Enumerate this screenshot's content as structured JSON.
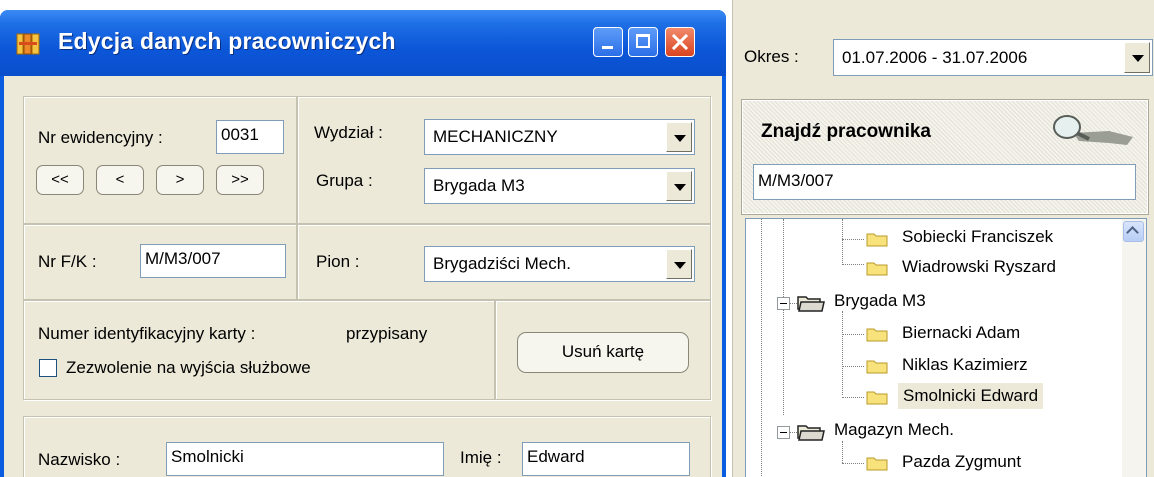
{
  "window": {
    "title": "Edycja danych pracowniczych"
  },
  "form": {
    "nr_ewidencyjny_label": "Nr ewidencyjny :",
    "nr_ewidencyjny_value": "0031",
    "nav": [
      "<<",
      "<",
      ">",
      ">>"
    ],
    "wydzial_label": "Wydział :",
    "wydzial_value": "MECHANICZNY",
    "grupa_label": "Grupa :",
    "grupa_value": "Brygada M3",
    "nr_fk_label": "Nr F/K :",
    "nr_fk_value": "M/M3/007",
    "pion_label": "Pion :",
    "pion_value": "Brygadziści Mech.",
    "karta_label": "Numer identyfikacyjny karty :",
    "karta_status": "przypisany",
    "usun_karte": "Usuń kartę",
    "zezwolenie_label": "Zezwolenie na wyjścia służbowe",
    "zezwolenie_checked": false,
    "nazwisko_label": "Nazwisko :",
    "nazwisko_value": "Smolnicki",
    "imie_label": "Imię :",
    "imie_value": "Edward"
  },
  "right_panel": {
    "okres_label": "Okres :",
    "okres_value": "01.07.2006 - 31.07.2006",
    "search_title": "Znajdź pracownika",
    "search_value": "M/M3/007",
    "tree": [
      {
        "label": "Sobiecki Franciszek",
        "type": "employee"
      },
      {
        "label": "Wiadrowski Ryszard",
        "type": "employee"
      },
      {
        "label": "Brygada M3",
        "type": "group",
        "expanded": true
      },
      {
        "label": "Biernacki Adam",
        "type": "employee"
      },
      {
        "label": "Niklas Kazimierz",
        "type": "employee"
      },
      {
        "label": "Smolnicki Edward",
        "type": "employee",
        "selected": true
      },
      {
        "label": "Magazyn Mech.",
        "type": "group",
        "expanded": true
      },
      {
        "label": "Pazda Zygmunt",
        "type": "employee"
      }
    ]
  },
  "colors": {
    "titlebar": "#0b56d8",
    "face": "#ece9d8",
    "folder": "#f8e27b",
    "selection": "#ece9d8"
  },
  "icons": [
    "app-icon",
    "minimize-icon",
    "maximize-icon",
    "close-icon",
    "magnifier-icon",
    "folder-icon",
    "group-folder-icon",
    "dropdown-arrow-icon",
    "scroll-up-icon"
  ]
}
